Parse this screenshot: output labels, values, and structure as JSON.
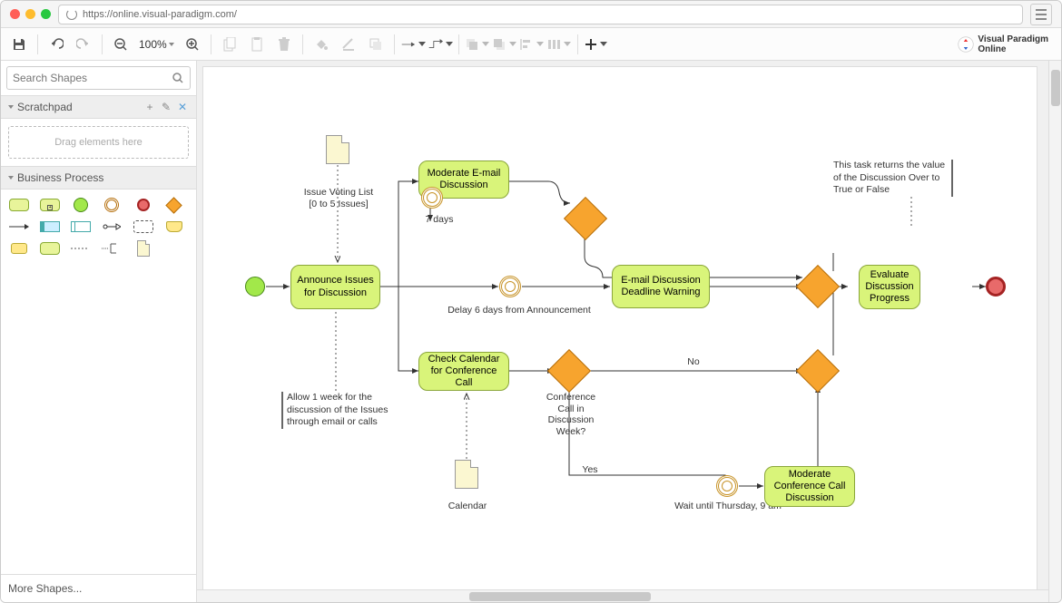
{
  "browser": {
    "url": "https://online.visual-paradigm.com/"
  },
  "toolbar": {
    "zoom_level": "100%"
  },
  "logo": {
    "line1": "Visual Paradigm",
    "line2": "Online"
  },
  "sidebar": {
    "search_placeholder": "Search Shapes",
    "scratchpad_title": "Scratchpad",
    "scratchpad_hint": "Drag elements here",
    "bp_title": "Business Process",
    "more_shapes": "More Shapes..."
  },
  "diagram": {
    "start": "",
    "tasks": {
      "announce": "Announce Issues for Discussion",
      "moderate_email": "Moderate E-mail Discussion",
      "email_warning": "E-mail Discussion Deadline Warning",
      "check_calendar": "Check Calendar for Conference Call",
      "moderate_call": "Moderate Conference Call Discussion",
      "evaluate": "Evaluate Discussion Progress"
    },
    "data_objects": {
      "issue_list": "Issue Voting List [0 to 5 Issues]",
      "calendar": "Calendar"
    },
    "annotations": {
      "allow_week": "Allow 1 week for the discussion of the Issues through email or calls",
      "return_value": "This task returns the value of the Discussion Over to True or False"
    },
    "labels": {
      "seven_days": "7 days",
      "delay_6": "Delay 6 days from Announcement",
      "conference_q": "Conference Call in Discussion Week?",
      "no": "No",
      "yes": "Yes",
      "wait_thursday": "Wait until Thursday, 9 am"
    }
  }
}
